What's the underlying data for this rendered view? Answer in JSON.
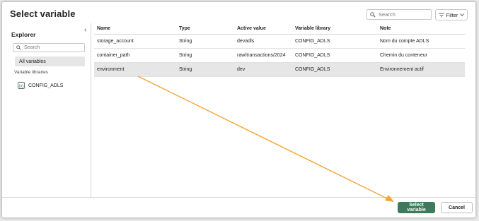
{
  "dialog": {
    "title": "Select variable"
  },
  "toolbar": {
    "search_placeholder": "Search",
    "filter_label": "Filter"
  },
  "explorer": {
    "title": "Explorer",
    "search_placeholder": "Search",
    "all_variables_label": "All variables",
    "libraries_heading": "Variable libraries",
    "libraries": [
      {
        "name": "CONFIG_ADLS",
        "icon": "variable-library-icon"
      }
    ]
  },
  "table": {
    "headers": [
      "Name",
      "Type",
      "Active value",
      "Variable library",
      "Note"
    ],
    "rows": [
      [
        "storage_account",
        "String",
        "devadls",
        "CONFIG_ADLS",
        "Nom du compte ADLS"
      ],
      [
        "container_path",
        "String",
        "raw/transactions/2024",
        "CONFIG_ADLS",
        "Chemin du conteneur"
      ],
      [
        "environment",
        "String",
        "dev",
        "CONFIG_ADLS",
        "Environnement actif"
      ]
    ],
    "selected_row": 2
  },
  "footer": {
    "select_label": "Select variable",
    "cancel_label": "Cancel"
  },
  "colors": {
    "primary_button": "#3f7a5d",
    "annotation_arrow": "#f2a533",
    "selected_row": "#e6e6e6"
  }
}
